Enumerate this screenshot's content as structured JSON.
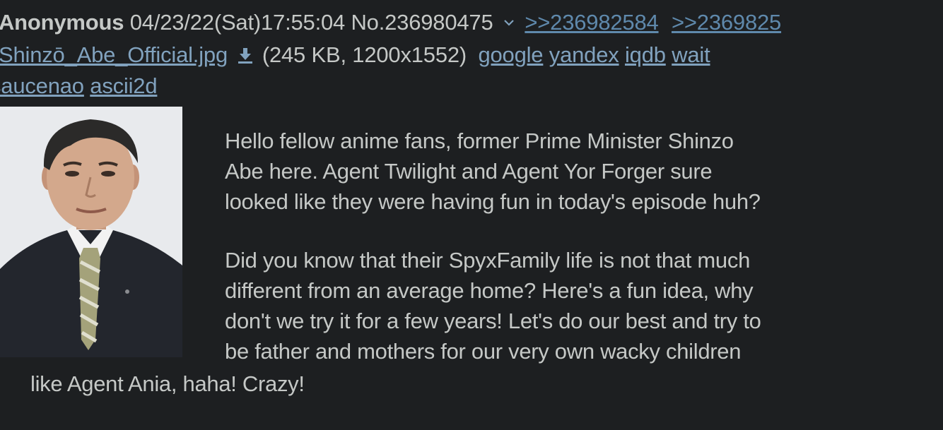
{
  "post": {
    "name": "Anonymous",
    "datetime": "04/23/22(Sat)17:55:04",
    "post_number": "No.236980475",
    "menu_icon": "chevron-down-icon",
    "replies": [
      ">>236982584",
      ">>2369825"
    ]
  },
  "file": {
    "filename": "Shinzō_Abe_Official.jpg",
    "download_icon": "download-icon",
    "info": "(245 KB, 1200x1552)",
    "search_links": [
      "google",
      "yandex",
      "iqdb",
      "wait",
      "saucenao",
      "ascii2d"
    ]
  },
  "comment": {
    "lines": [
      "Hello fellow anime fans, former Prime Minister Shinzo",
      "Abe here. Agent Twilight and Agent Yor Forger sure",
      "looked like they were having fun in today's episode huh?",
      "Did you know that their SpyxFamily life is not that much",
      "different from an average home? Here's a fun idea, why",
      "don't we try it for a few years! Let's do our best and try to",
      "be father and mothers for our very own wacky children",
      "like Agent Ania, haha! Crazy!"
    ]
  },
  "colors": {
    "background": "#1d1f21",
    "text": "#c5c8c6",
    "link": "#81a2be",
    "quotelink": "#5f89ac"
  }
}
